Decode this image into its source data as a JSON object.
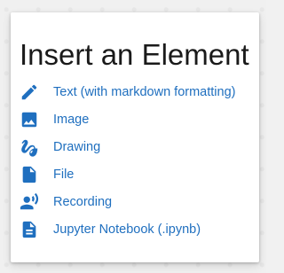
{
  "dialog": {
    "title": "Insert an Element",
    "items": [
      {
        "label": "Text (with markdown formatting)",
        "icon": "pencil-icon"
      },
      {
        "label": "Image",
        "icon": "image-icon"
      },
      {
        "label": "Drawing",
        "icon": "drawing-icon"
      },
      {
        "label": "File",
        "icon": "file-icon"
      },
      {
        "label": "Recording",
        "icon": "recording-icon"
      },
      {
        "label": "Jupyter Notebook (.ipynb)",
        "icon": "notebook-icon"
      }
    ]
  },
  "colors": {
    "accent": "#1f6fbf",
    "title": "#1a1a1a",
    "background": "#f0f0f0",
    "dialog": "#ffffff"
  }
}
